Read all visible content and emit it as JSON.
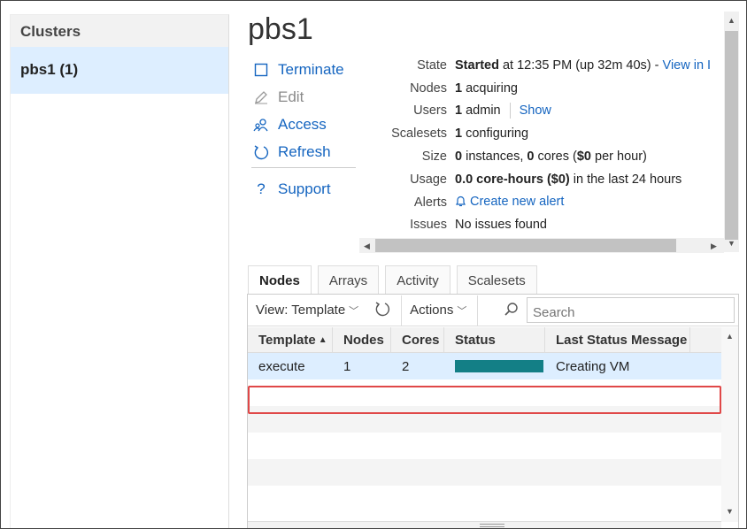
{
  "sidebar": {
    "header": "Clusters",
    "items": [
      {
        "label": "pbs1 (1)"
      }
    ]
  },
  "cluster": {
    "title": "pbs1"
  },
  "actions": {
    "terminate": "Terminate",
    "edit": "Edit",
    "access": "Access",
    "refresh": "Refresh",
    "support": "Support"
  },
  "details": {
    "state": {
      "label": "State",
      "value_bold": "Started",
      "value_rest": " at 12:35 PM (up 32m 40s) - ",
      "link": "View in I"
    },
    "nodes": {
      "label": "Nodes",
      "count": "1",
      "rest": " acquiring"
    },
    "users": {
      "label": "Users",
      "count": "1",
      "rest": " admin",
      "link": "Show"
    },
    "scalesets": {
      "label": "Scalesets",
      "count": "1",
      "rest": " configuring"
    },
    "size": {
      "label": "Size",
      "instances": "0",
      "instances_label": " instances, ",
      "cores": "0",
      "cores_label": " cores (",
      "price": "$0",
      "price_label": " per hour)"
    },
    "usage": {
      "label": "Usage",
      "hours": "0.0 core-hours ($0)",
      "rest": " in the last 24 hours"
    },
    "alerts": {
      "label": "Alerts",
      "link": "Create new alert"
    },
    "issues": {
      "label": "Issues",
      "value": "No issues found"
    }
  },
  "tabs": [
    "Nodes",
    "Arrays",
    "Activity",
    "Scalesets"
  ],
  "active_tab": "Nodes",
  "toolbar": {
    "view": "View: Template",
    "actions": "Actions",
    "search_placeholder": "Search"
  },
  "grid": {
    "columns": [
      "Template",
      "Nodes",
      "Cores",
      "Status",
      "Last Status Message"
    ],
    "rows": [
      {
        "template": "execute",
        "nodes": "1",
        "cores": "2",
        "status_message": "Creating VM"
      }
    ]
  },
  "colors": {
    "accent": "#1565c0",
    "status_bar": "#137f86",
    "highlight": "#e04848",
    "selected": "#ddeeff"
  }
}
